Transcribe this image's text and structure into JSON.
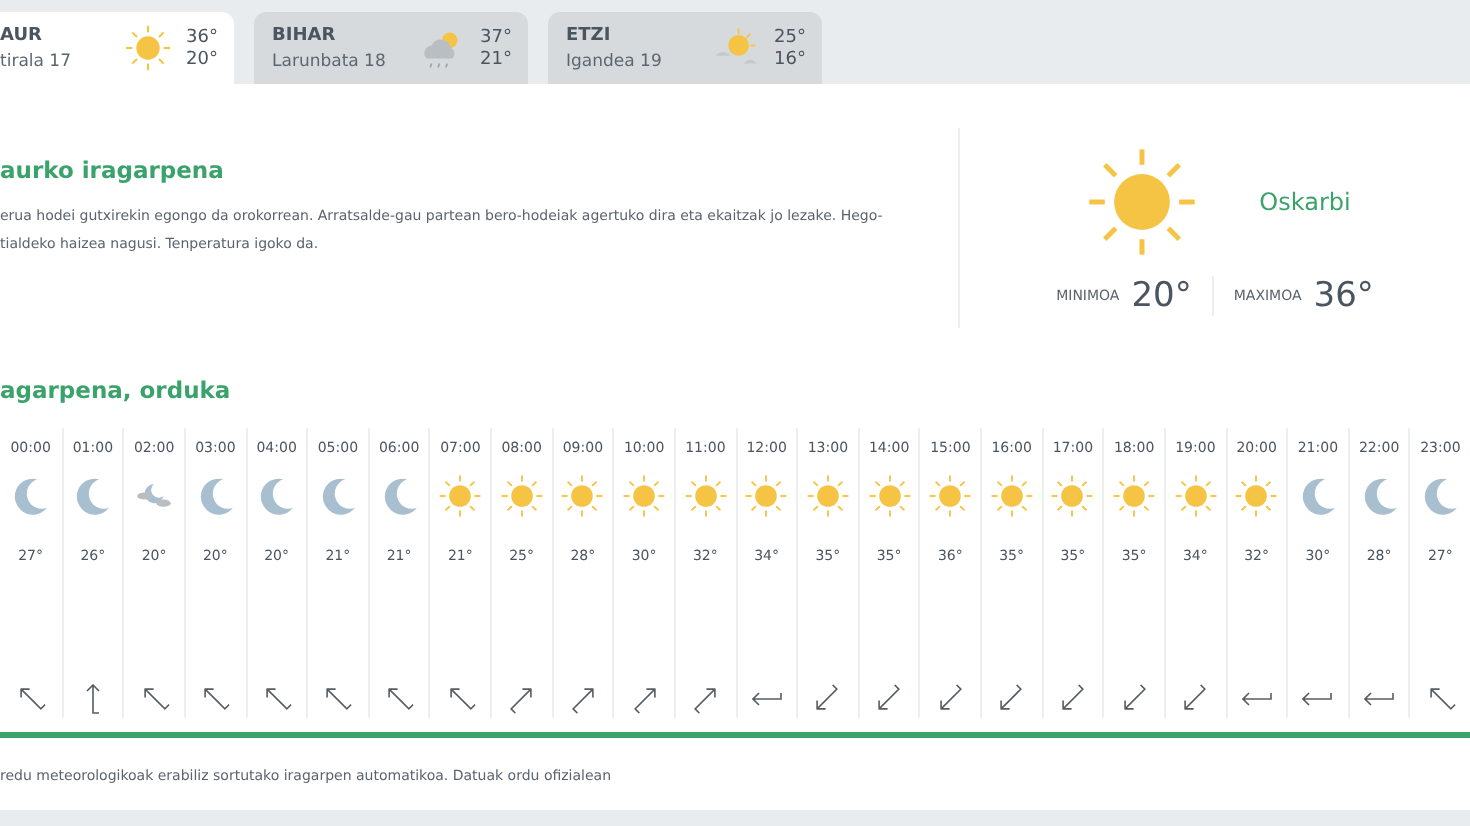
{
  "day_tabs": [
    {
      "day": "AUR",
      "date": "tirala 17",
      "kind": "sun",
      "max": "36°",
      "min": "20°",
      "selected": true
    },
    {
      "day": "BIHAR",
      "date": "Larunbata 18",
      "kind": "cloud-rain-sun",
      "max": "37°",
      "min": "21°",
      "selected": false
    },
    {
      "day": "ETZI",
      "date": "Igandea 19",
      "kind": "sun-cloud",
      "max": "25°",
      "min": "16°",
      "selected": false
    }
  ],
  "forecast": {
    "title": "aurko iragarpena",
    "text_lines": [
      "erua hodei gutxirekin egongo da orokorrean. Arratsalde-gau partean bero-hodeiak agertuko dira eta ekaitzak jo lezake. Hego-",
      "tialdeko haizea nagusi. Tenperatura igoko da."
    ]
  },
  "summary": {
    "kind": "sun",
    "condition": "Oskarbi",
    "min_label": "MINIMOA",
    "min": "20°",
    "max_label": "MAXIMOA",
    "max": "36°"
  },
  "hourly": {
    "title": "agarpena, orduka",
    "hours": [
      {
        "time": "00:00",
        "kind": "moon",
        "temp": "27°",
        "wind": {
          "kind": "nw"
        }
      },
      {
        "time": "01:00",
        "kind": "moon",
        "temp": "26°",
        "wind": {
          "kind": "n"
        }
      },
      {
        "time": "02:00",
        "kind": "moon-cloud",
        "temp": "20°",
        "wind": {
          "kind": "nw"
        }
      },
      {
        "time": "03:00",
        "kind": "moon",
        "temp": "20°",
        "wind": {
          "kind": "nw"
        }
      },
      {
        "time": "04:00",
        "kind": "moon",
        "temp": "20°",
        "wind": {
          "kind": "nw"
        }
      },
      {
        "time": "05:00",
        "kind": "moon",
        "temp": "21°",
        "wind": {
          "kind": "nw"
        }
      },
      {
        "time": "06:00",
        "kind": "moon",
        "temp": "21°",
        "wind": {
          "kind": "nw"
        }
      },
      {
        "time": "07:00",
        "kind": "sun",
        "temp": "21°",
        "wind": {
          "kind": "nw"
        }
      },
      {
        "time": "08:00",
        "kind": "sun",
        "temp": "25°",
        "wind": {
          "kind": "ne"
        }
      },
      {
        "time": "09:00",
        "kind": "sun",
        "temp": "28°",
        "wind": {
          "kind": "ne"
        }
      },
      {
        "time": "10:00",
        "kind": "sun",
        "temp": "30°",
        "wind": {
          "kind": "ne"
        }
      },
      {
        "time": "11:00",
        "kind": "sun",
        "temp": "32°",
        "wind": {
          "kind": "ne"
        }
      },
      {
        "time": "12:00",
        "kind": "sun",
        "temp": "34°",
        "wind": {
          "kind": "w"
        }
      },
      {
        "time": "13:00",
        "kind": "sun",
        "temp": "35°",
        "wind": {
          "kind": "sw"
        }
      },
      {
        "time": "14:00",
        "kind": "sun",
        "temp": "35°",
        "wind": {
          "kind": "sw"
        }
      },
      {
        "time": "15:00",
        "kind": "sun",
        "temp": "36°",
        "wind": {
          "kind": "sw"
        }
      },
      {
        "time": "16:00",
        "kind": "sun",
        "temp": "35°",
        "wind": {
          "kind": "sw"
        }
      },
      {
        "time": "17:00",
        "kind": "sun",
        "temp": "35°",
        "wind": {
          "kind": "sw"
        }
      },
      {
        "time": "18:00",
        "kind": "sun",
        "temp": "35°",
        "wind": {
          "kind": "sw"
        }
      },
      {
        "time": "19:00",
        "kind": "sun",
        "temp": "34°",
        "wind": {
          "kind": "sw"
        }
      },
      {
        "time": "20:00",
        "kind": "sun",
        "temp": "32°",
        "wind": {
          "kind": "w"
        }
      },
      {
        "time": "21:00",
        "kind": "moon",
        "temp": "30°",
        "wind": {
          "kind": "w"
        }
      },
      {
        "time": "22:00",
        "kind": "moon",
        "temp": "28°",
        "wind": {
          "kind": "w"
        }
      },
      {
        "time": "23:00",
        "kind": "moon",
        "temp": "27°",
        "wind": {
          "kind": "nw"
        }
      }
    ]
  },
  "footer": "redu meteorologikoak erabiliz sortutako iragarpen automatikoa. Datuak ordu ofizialean"
}
